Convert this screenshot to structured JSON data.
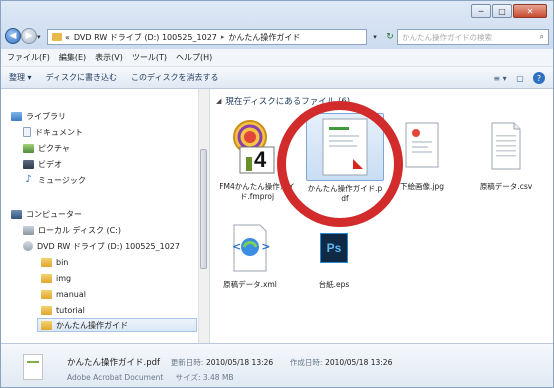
{
  "window": {
    "buttons": {
      "minimize": "─",
      "maximize": "□",
      "close": "✕"
    }
  },
  "nav": {
    "back_icon": "◀",
    "forward_icon": "▶",
    "dropdown_icon": "▾",
    "address": {
      "prefix": "«",
      "segment1": "DVD RW ドライブ (D:) 100525_1027",
      "separator": "▸",
      "segment2": "かんたん操作ガイド"
    },
    "address_dropdown": "▾",
    "refresh_icon": "↻",
    "search_placeholder": "かんたん操作ガイドの検索",
    "search_icon": "⌕"
  },
  "menubar": [
    "ファイル(F)",
    "編集(E)",
    "表示(V)",
    "ツール(T)",
    "ヘルプ(H)"
  ],
  "toolbar": {
    "organize": "整理 ▾",
    "burn": "ディスクに書き込む",
    "erase": "このディスクを消去する",
    "view_icon": "≡ ▾",
    "pane_icon": "▢",
    "help_icon": "?"
  },
  "sidebar": {
    "library": "ライブラリ",
    "documents": "ドキュメント",
    "pictures": "ピクチャ",
    "videos": "ビデオ",
    "music": "ミュージック",
    "computer": "コンピューター",
    "local_disk": "ローカル ディスク (C:)",
    "dvd_drive": "DVD RW ドライブ (D:) 100525_1027",
    "folders": [
      "bin",
      "img",
      "manual",
      "tutorial"
    ],
    "selected_folder": "かんたん操作ガイド"
  },
  "content": {
    "group_header": "現在ディスクにあるファイル (6)",
    "files": [
      {
        "name": "FM4かんたん操作ガイド.fmproj",
        "icon": "fm4-project-icon"
      },
      {
        "name": "かんたん操作ガイド.pdf",
        "icon": "pdf-icon",
        "selected": true
      },
      {
        "name": "下絵画像.jpg",
        "icon": "jpg-icon"
      },
      {
        "name": "原稿データ.csv",
        "icon": "csv-icon"
      },
      {
        "name": "原稿データ.xml",
        "icon": "xml-icon"
      },
      {
        "name": "台紙.eps",
        "icon": "photoshop-eps-icon"
      }
    ],
    "fm4_number": "4",
    "ps_label": "Ps",
    "xml_label": "<>"
  },
  "status": {
    "filename": "かんたん操作ガイド.pdf",
    "updated_label": "更新日時:",
    "updated_value": "2010/05/18 13:26",
    "created_label": "作成日時:",
    "created_value": "2010/05/18 13:26",
    "type": "Adobe Acrobat Document",
    "size_label": "サイズ:",
    "size_value": "3.48 MB"
  },
  "colors": {
    "annotation": "#d22b2b",
    "selection": "#c9ddf3"
  }
}
